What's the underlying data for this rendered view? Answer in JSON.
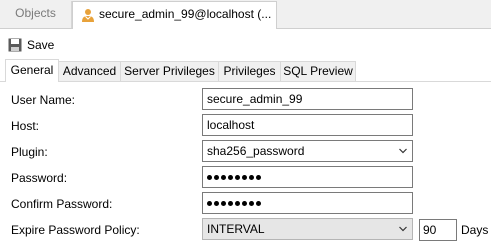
{
  "tabs": {
    "objects": "Objects",
    "user": "secure_admin_99@localhost (..."
  },
  "toolbar": {
    "save_label": "Save"
  },
  "subtabs": [
    "General",
    "Advanced",
    "Server Privileges",
    "Privileges",
    "SQL Preview"
  ],
  "form": {
    "user_name_label": "User Name:",
    "user_name_value": "secure_admin_99",
    "host_label": "Host:",
    "host_value": "localhost",
    "plugin_label": "Plugin:",
    "plugin_value": "sha256_password",
    "password_label": "Password:",
    "confirm_password_label": "Confirm Password:",
    "expire_label": "Expire Password Policy:",
    "expire_value": "INTERVAL",
    "expire_days_value": "90",
    "days_label": "Days"
  },
  "icons": {
    "user_tab": "user-icon",
    "save": "save-icon"
  }
}
